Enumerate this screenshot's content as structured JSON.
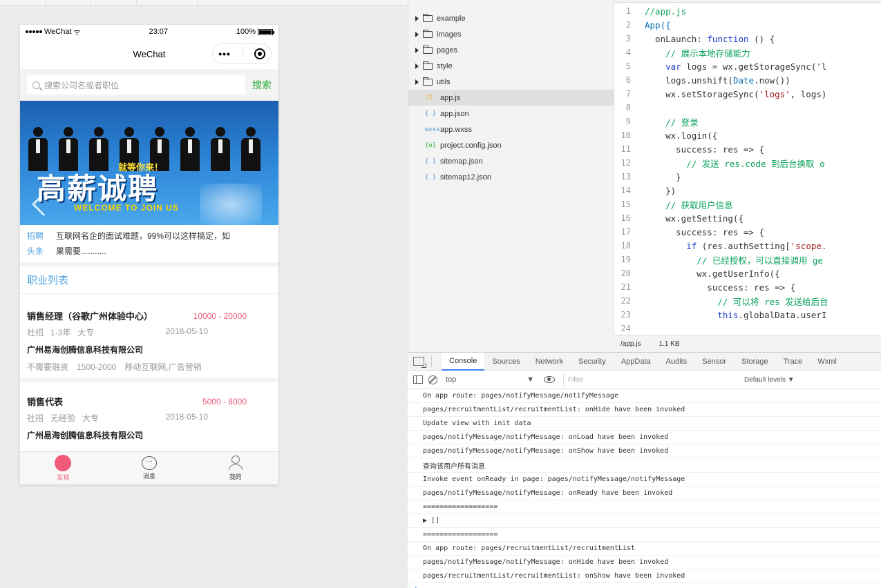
{
  "phone": {
    "status": {
      "carrier": "WeChat",
      "time": "23:07",
      "battery": "100%"
    },
    "nav_title": "WeChat",
    "capsule_dots": "•••",
    "search": {
      "placeholder": "搜索公司名或者职位",
      "button": "搜索"
    },
    "banner": {
      "badge": "就等你来！",
      "title": "高薪诚聘",
      "subtitle": "WELCOME TO JOIN US"
    },
    "headline": {
      "tag1": "招聘",
      "tag2": "头条",
      "text1": "互联网名企的面试难题，99%可以这样搞定，如",
      "text2": "果需要..........."
    },
    "section_title": "职业列表",
    "jobs": [
      {
        "title": "销售经理（谷歌广州体验中心）",
        "salary": "10000 - 20000",
        "type": "社招",
        "exp": "1-3年",
        "edu": "大专",
        "date": "2018-05-10",
        "company": "广州易海创腾信息科技有限公司",
        "extra1": "不需要融资",
        "extra2": "1500-2000",
        "extra3": "移动互联网,广告营销"
      },
      {
        "title": "销售代表",
        "salary": "5000 - 8000",
        "type": "社招",
        "exp": "无经验",
        "edu": "大专",
        "date": "2018-05-10",
        "company": "广州易海创腾信息科技有限公司"
      }
    ],
    "tabs": [
      {
        "label": "发现",
        "icon": "home-circle-icon"
      },
      {
        "label": "消息",
        "icon": "message-icon",
        "glyph": "···"
      },
      {
        "label": "我的",
        "icon": "user-icon"
      }
    ]
  },
  "file_tree": {
    "folders": [
      "example",
      "images",
      "pages",
      "style",
      "utils"
    ],
    "files": [
      {
        "icon": "JS",
        "name": "app.js"
      },
      {
        "icon": "{ }",
        "name": "app.json"
      },
      {
        "icon": "wxss",
        "name": "app.wxss"
      },
      {
        "icon": "{o}",
        "name": "project.config.json"
      },
      {
        "icon": "{ }",
        "name": "sitemap.json"
      },
      {
        "icon": "{ }",
        "name": "sitemap12.json"
      }
    ]
  },
  "editor": {
    "lines": [
      "1",
      "2",
      "3",
      "4",
      "5",
      "6",
      "7",
      "8",
      "9",
      "10",
      "11",
      "12",
      "13",
      "14",
      "15",
      "16",
      "17",
      "18",
      "19",
      "20",
      "21",
      "22",
      "23",
      "24"
    ],
    "code": {
      "l1": "//app.js",
      "l2": "App({",
      "l3a": "  onLaunch: ",
      "l3b": "function",
      "l3c": " () {",
      "l4": "    // 展示本地存储能力",
      "l5a": "    ",
      "l5b": "var",
      "l5c": " logs = wx.getStorageSync('l",
      "l6a": "    logs.unshift(",
      "l6b": "Date",
      "l6c": ".now())",
      "l7a": "    wx.setStorageSync(",
      "l7b": "'logs'",
      "l7c": ", logs)",
      "l8": "",
      "l9": "    // 登录",
      "l10": "    wx.login({",
      "l11": "      success: res => {",
      "l12": "        // 发送 res.code 到后台换取 o",
      "l13": "      }",
      "l14": "    })",
      "l15": "    // 获取用户信息",
      "l16": "    wx.getSetting({",
      "l17": "      success: res => {",
      "l18a": "        ",
      "l18b": "if",
      "l18c": " (res.authSetting[",
      "l18d": "'scope.",
      "l19": "          // 已经授权，可以直接调用 ge",
      "l20": "          wx.getUserInfo({",
      "l21": "            success: res => {",
      "l22": "              // 可以将 res 发送给后台",
      "l23a": "              ",
      "l23b": "this",
      "l23c": ".globalData.userI",
      "l24": ""
    },
    "status_file": "/app.js",
    "status_size": "1.1 KB"
  },
  "devtools": {
    "tabs": [
      "Console",
      "Sources",
      "Network",
      "Security",
      "AppData",
      "Audits",
      "Sensor",
      "Storage",
      "Trace",
      "Wxml"
    ],
    "context": "top",
    "context_caret": "▼",
    "filter_placeholder": "Filter",
    "levels": "Default levels ▼",
    "console": [
      "On app route: pages/notifyMessage/notifyMessage",
      "pages/recruitmentList/recruitmentList: onHide have been invoked",
      "Update view with init data",
      "pages/notifyMessage/notifyMessage: onLoad have been invoked",
      "pages/notifyMessage/notifyMessage: onShow have been invoked",
      "查询该用户所有消息",
      "Invoke event onReady in page: pages/notifyMessage/notifyMessage",
      "pages/notifyMessage/notifyMessage: onReady have been invoked",
      "==================",
      "▶ []",
      "==================",
      "On app route: pages/recruitmentList/recruitmentList",
      "pages/notifyMessage/notifyMessage: onHide have been invoked",
      "pages/recruitmentList/recruitmentList: onShow have been invoked"
    ],
    "prompt": "›"
  }
}
